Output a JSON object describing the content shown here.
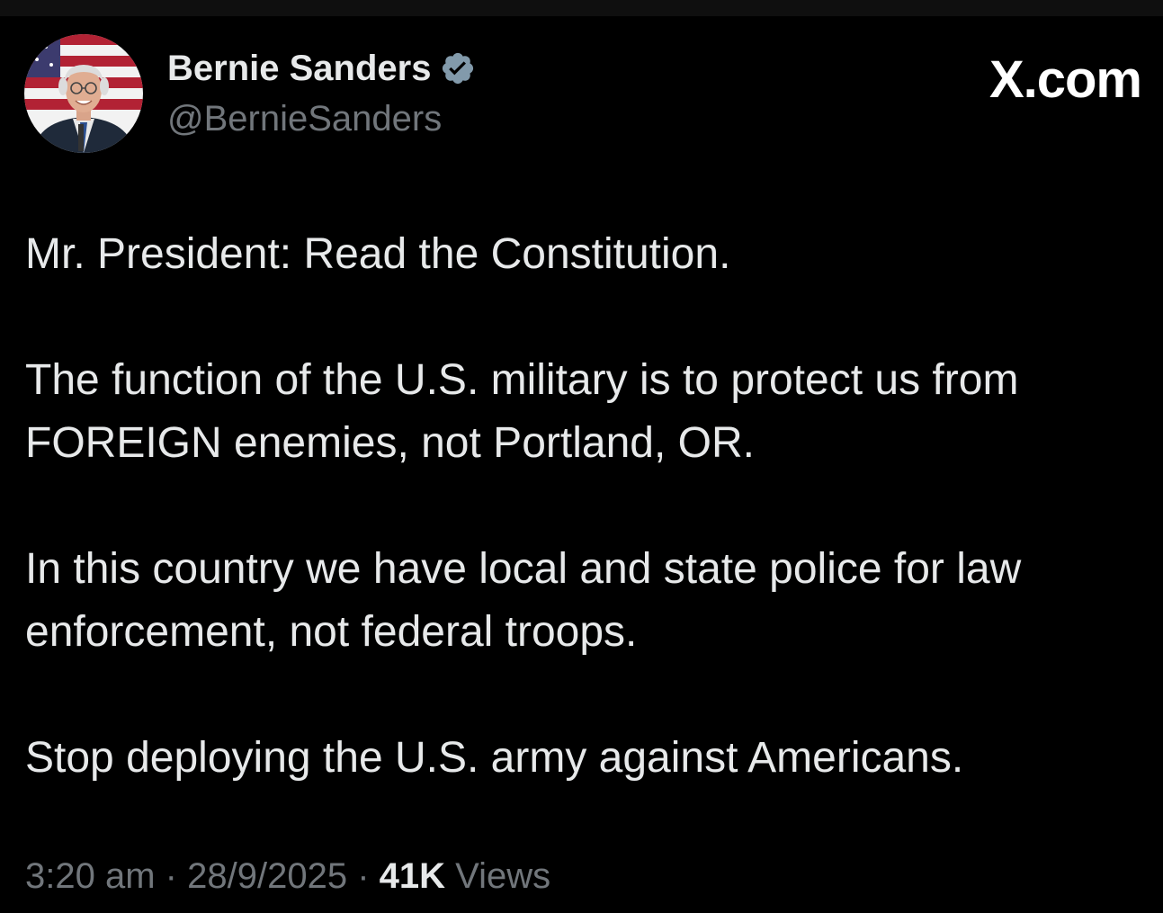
{
  "author": {
    "display_name": "Bernie Sanders",
    "handle": "@BernieSanders",
    "verified": true,
    "verified_color": "#829aab",
    "avatar": "profile-photo"
  },
  "site_label": "X.com",
  "tweet": {
    "paragraphs": [
      "Mr. President: Read the Constitution.",
      "The function of the U.S. military is to protect us from FOREIGN enemies, not Portland, OR.",
      "In this country we have local and state police for law enforcement, not federal troops.",
      "Stop deploying the U.S. army against Americans."
    ]
  },
  "meta": {
    "time": "3:20 am",
    "separator": "·",
    "date": "28/9/2025",
    "views_count": "41K",
    "views_label": "Views"
  },
  "colors": {
    "background": "#000000",
    "text_primary": "#e7e9ea",
    "text_secondary": "#71767b"
  }
}
